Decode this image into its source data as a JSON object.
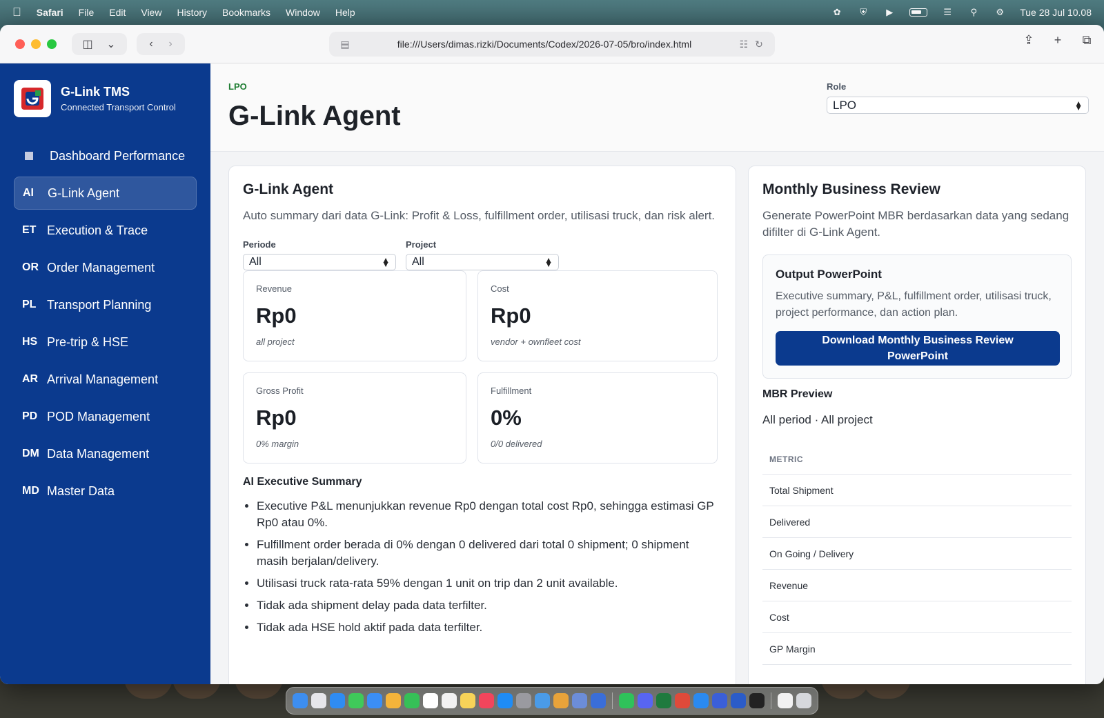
{
  "menubar": {
    "app_name": "Safari",
    "items": [
      "File",
      "Edit",
      "View",
      "History",
      "Bookmarks",
      "Window",
      "Help"
    ],
    "datetime": "Tue 28 Jul  10.08"
  },
  "browser": {
    "url": "file:///Users/dimas.rizki/Documents/Codex/2026-07-05/bro/index.html"
  },
  "sidebar": {
    "brand_name": "G-Link TMS",
    "brand_sub": "Connected Transport Control",
    "items": [
      {
        "code": "",
        "label": "Dashboard Performance"
      },
      {
        "code": "AI",
        "label": "G-Link Agent"
      },
      {
        "code": "ET",
        "label": "Execution & Trace"
      },
      {
        "code": "OR",
        "label": "Order Management"
      },
      {
        "code": "PL",
        "label": "Transport Planning"
      },
      {
        "code": "HS",
        "label": "Pre-trip & HSE"
      },
      {
        "code": "AR",
        "label": "Arrival Management"
      },
      {
        "code": "PD",
        "label": "POD Management"
      },
      {
        "code": "DM",
        "label": "Data Management"
      },
      {
        "code": "MD",
        "label": "Master Data"
      }
    ]
  },
  "header": {
    "eyebrow": "LPO",
    "title": "G-Link Agent",
    "role_label": "Role",
    "role_value": "LPO"
  },
  "agent": {
    "title": "G-Link Agent",
    "description": "Auto summary dari data G-Link: Profit & Loss, fulfillment order, utilisasi truck, dan risk alert.",
    "filters": {
      "periode_label": "Periode",
      "periode_value": "All",
      "project_label": "Project",
      "project_value": "All"
    },
    "metrics": [
      {
        "label": "Revenue",
        "value": "Rp0",
        "note": "all project"
      },
      {
        "label": "Cost",
        "value": "Rp0",
        "note": "vendor + ownfleet cost"
      },
      {
        "label": "Gross Profit",
        "value": "Rp0",
        "note": "0% margin"
      },
      {
        "label": "Fulfillment",
        "value": "0%",
        "note": "0/0 delivered"
      }
    ],
    "summary_title": "AI Executive Summary",
    "summary": [
      "Executive P&L menunjukkan revenue Rp0 dengan total cost Rp0, sehingga estimasi GP Rp0 atau 0%.",
      "Fulfillment order berada di 0% dengan 0 delivered dari total 0 shipment; 0 shipment masih berjalan/delivery.",
      "Utilisasi truck rata-rata 59% dengan 1 unit on trip dan 2 unit available.",
      "Tidak ada shipment delay pada data terfilter.",
      "Tidak ada HSE hold aktif pada data terfilter."
    ]
  },
  "mbr": {
    "title": "Monthly Business Review",
    "description": "Generate PowerPoint MBR berdasarkan data yang sedang difilter di G-Link Agent.",
    "output_title": "Output PowerPoint",
    "output_desc": "Executive summary, P&L, fulfillment order, utilisasi truck, project performance, dan action plan.",
    "download_label": "Download Monthly Business Review PowerPoint",
    "preview_title": "MBR Preview",
    "preview_sub": "All period · All project",
    "table_header": "METRIC",
    "table_rows": [
      "Total Shipment",
      "Delivered",
      "On Going / Delivery",
      "Revenue",
      "Cost",
      "GP Margin"
    ]
  },
  "colors": {
    "sidebar": "#0b3a8e",
    "accent_green": "#1e7d32",
    "button": "#0b3a8e"
  }
}
